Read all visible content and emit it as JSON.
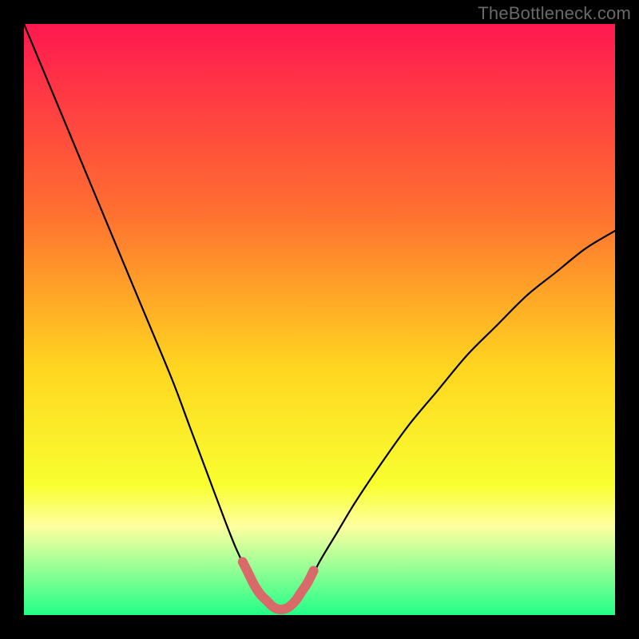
{
  "watermark": "TheBottleneck.com",
  "colors": {
    "bg": "#000000",
    "gradient_top": "#ff1850",
    "gradient_mid_upper": "#ff7030",
    "gradient_mid": "#ffd520",
    "gradient_mid_lower": "#f8ff30",
    "gradient_band": "#ffffa0",
    "gradient_bottom": "#22ff88",
    "curve": "#000000",
    "segment": "#d86a6a",
    "watermark_text": "#696969"
  },
  "chart_data": {
    "type": "line",
    "title": "",
    "xlabel": "",
    "ylabel": "",
    "xlim": [
      0,
      100
    ],
    "ylim": [
      0,
      100
    ],
    "grid": false,
    "series": [
      {
        "name": "bottleneck-curve",
        "x": [
          0,
          5,
          10,
          15,
          20,
          25,
          28,
          31,
          34,
          36,
          38,
          40,
          41,
          42,
          43,
          44,
          45,
          46,
          48,
          50,
          53,
          56,
          60,
          65,
          70,
          75,
          80,
          85,
          90,
          95,
          100
        ],
        "values": [
          100,
          88,
          76,
          64,
          52,
          40,
          32,
          24,
          16,
          11,
          7,
          4,
          2.5,
          1.5,
          1,
          1,
          1.5,
          2.5,
          5,
          9,
          14,
          19,
          25,
          32,
          38,
          44,
          49,
          54,
          58,
          62,
          65
        ]
      },
      {
        "name": "optimal-segment",
        "x": [
          37,
          38,
          39,
          40,
          41,
          42,
          43,
          44,
          45,
          46,
          47,
          48,
          49
        ],
        "values": [
          9,
          7,
          5,
          3.5,
          2.5,
          1.5,
          1,
          1,
          1.5,
          2.5,
          4,
          5.5,
          7.5
        ]
      }
    ],
    "annotations": []
  }
}
